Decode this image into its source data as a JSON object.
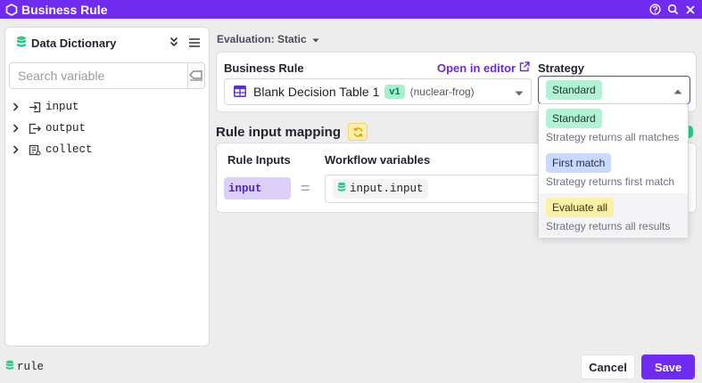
{
  "window": {
    "title": "Business Rule",
    "icons": [
      "hexagon-logo-icon",
      "help-icon",
      "search-icon",
      "close-icon"
    ]
  },
  "sidebar": {
    "title": "Data Dictionary",
    "search": {
      "placeholder": "Search variable",
      "value": ""
    },
    "items": [
      {
        "label": "input",
        "icon": "input-icon"
      },
      {
        "label": "output",
        "icon": "output-icon"
      },
      {
        "label": "collect",
        "icon": "collect-icon"
      }
    ]
  },
  "evaluation": {
    "label": "Evaluation: Static"
  },
  "business_rule": {
    "label": "Business Rule",
    "open_editor": "Open in editor",
    "selected": {
      "name": "Blank Decision Table 1",
      "version": "v1",
      "slug": "(nuclear-frog)"
    }
  },
  "strategy": {
    "label": "Strategy",
    "selected": "Standard",
    "options": [
      {
        "label": "Standard",
        "description": "Strategy returns all matches",
        "color": "#b3f0d4"
      },
      {
        "label": "First match",
        "description": "Strategy returns first match",
        "color": "#c9d9fb"
      },
      {
        "label": "Evaluate all",
        "description": "Strategy returns all results",
        "color": "#fbf1a6"
      }
    ]
  },
  "mapping": {
    "title": "Rule input mapping",
    "headers": {
      "inputs": "Rule Inputs",
      "workflow": "Workflow variables"
    },
    "rows": [
      {
        "input": "input",
        "variable": "input.input"
      }
    ]
  },
  "footer": {
    "rule_label": "rule",
    "cancel": "Cancel",
    "save": "Save"
  },
  "colors": {
    "accent": "#6f2cf0",
    "db_icon": "#2ec987"
  }
}
